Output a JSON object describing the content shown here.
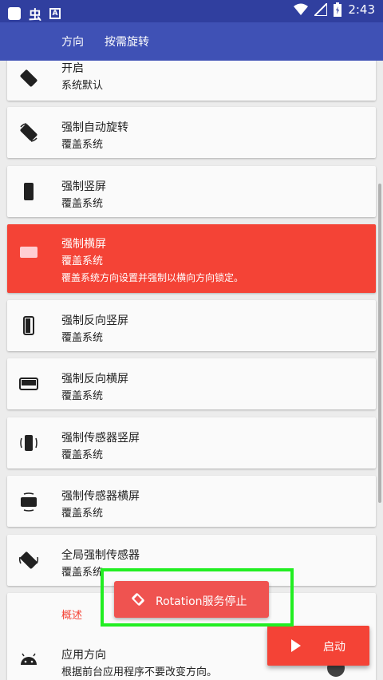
{
  "status_bar": {
    "time": "2:43",
    "app_glyph": "虫",
    "icons": [
      "square-icon",
      "bug-icon",
      "a-icon",
      "wifi-icon",
      "signal-icon",
      "battery-icon"
    ]
  },
  "toolbar": {
    "tabs": [
      "方向",
      "按需旋转"
    ]
  },
  "items": [
    {
      "title": "开启",
      "subtitle": "系统默认",
      "icon": "rotate-default-icon"
    },
    {
      "title": "强制自动旋转",
      "subtitle": "覆盖系统",
      "icon": "auto-rotate-icon"
    },
    {
      "title": "强制竖屏",
      "subtitle": "覆盖系统",
      "icon": "portrait-icon"
    },
    {
      "title": "强制横屏",
      "subtitle": "覆盖系统",
      "description": "覆盖系统方向设置并强制以横向方向锁定。",
      "icon": "landscape-icon",
      "active": true
    },
    {
      "title": "强制反向竖屏",
      "subtitle": "覆盖系统",
      "icon": "reverse-portrait-icon"
    },
    {
      "title": "强制反向横屏",
      "subtitle": "覆盖系统",
      "icon": "reverse-landscape-icon"
    },
    {
      "title": "强制传感器竖屏",
      "subtitle": "覆盖系统",
      "icon": "sensor-portrait-icon"
    },
    {
      "title": "强制传感器横屏",
      "subtitle": "覆盖系统",
      "icon": "sensor-landscape-icon"
    },
    {
      "title": "全局强制传感器",
      "subtitle": "覆盖系统",
      "icon": "global-sensor-icon"
    }
  ],
  "overview": {
    "section_label": "概述",
    "title": "应用方向",
    "subtitle": "根据前台应用程序不要改变方向。",
    "icon": "android-icon"
  },
  "toast": {
    "text": "Rotation服务停止"
  },
  "fab": {
    "label": "启动"
  },
  "colors": {
    "primary": "#3f51b5",
    "primary_dark": "#303f9f",
    "accent": "#f44336",
    "highlight": "#22ee22"
  }
}
